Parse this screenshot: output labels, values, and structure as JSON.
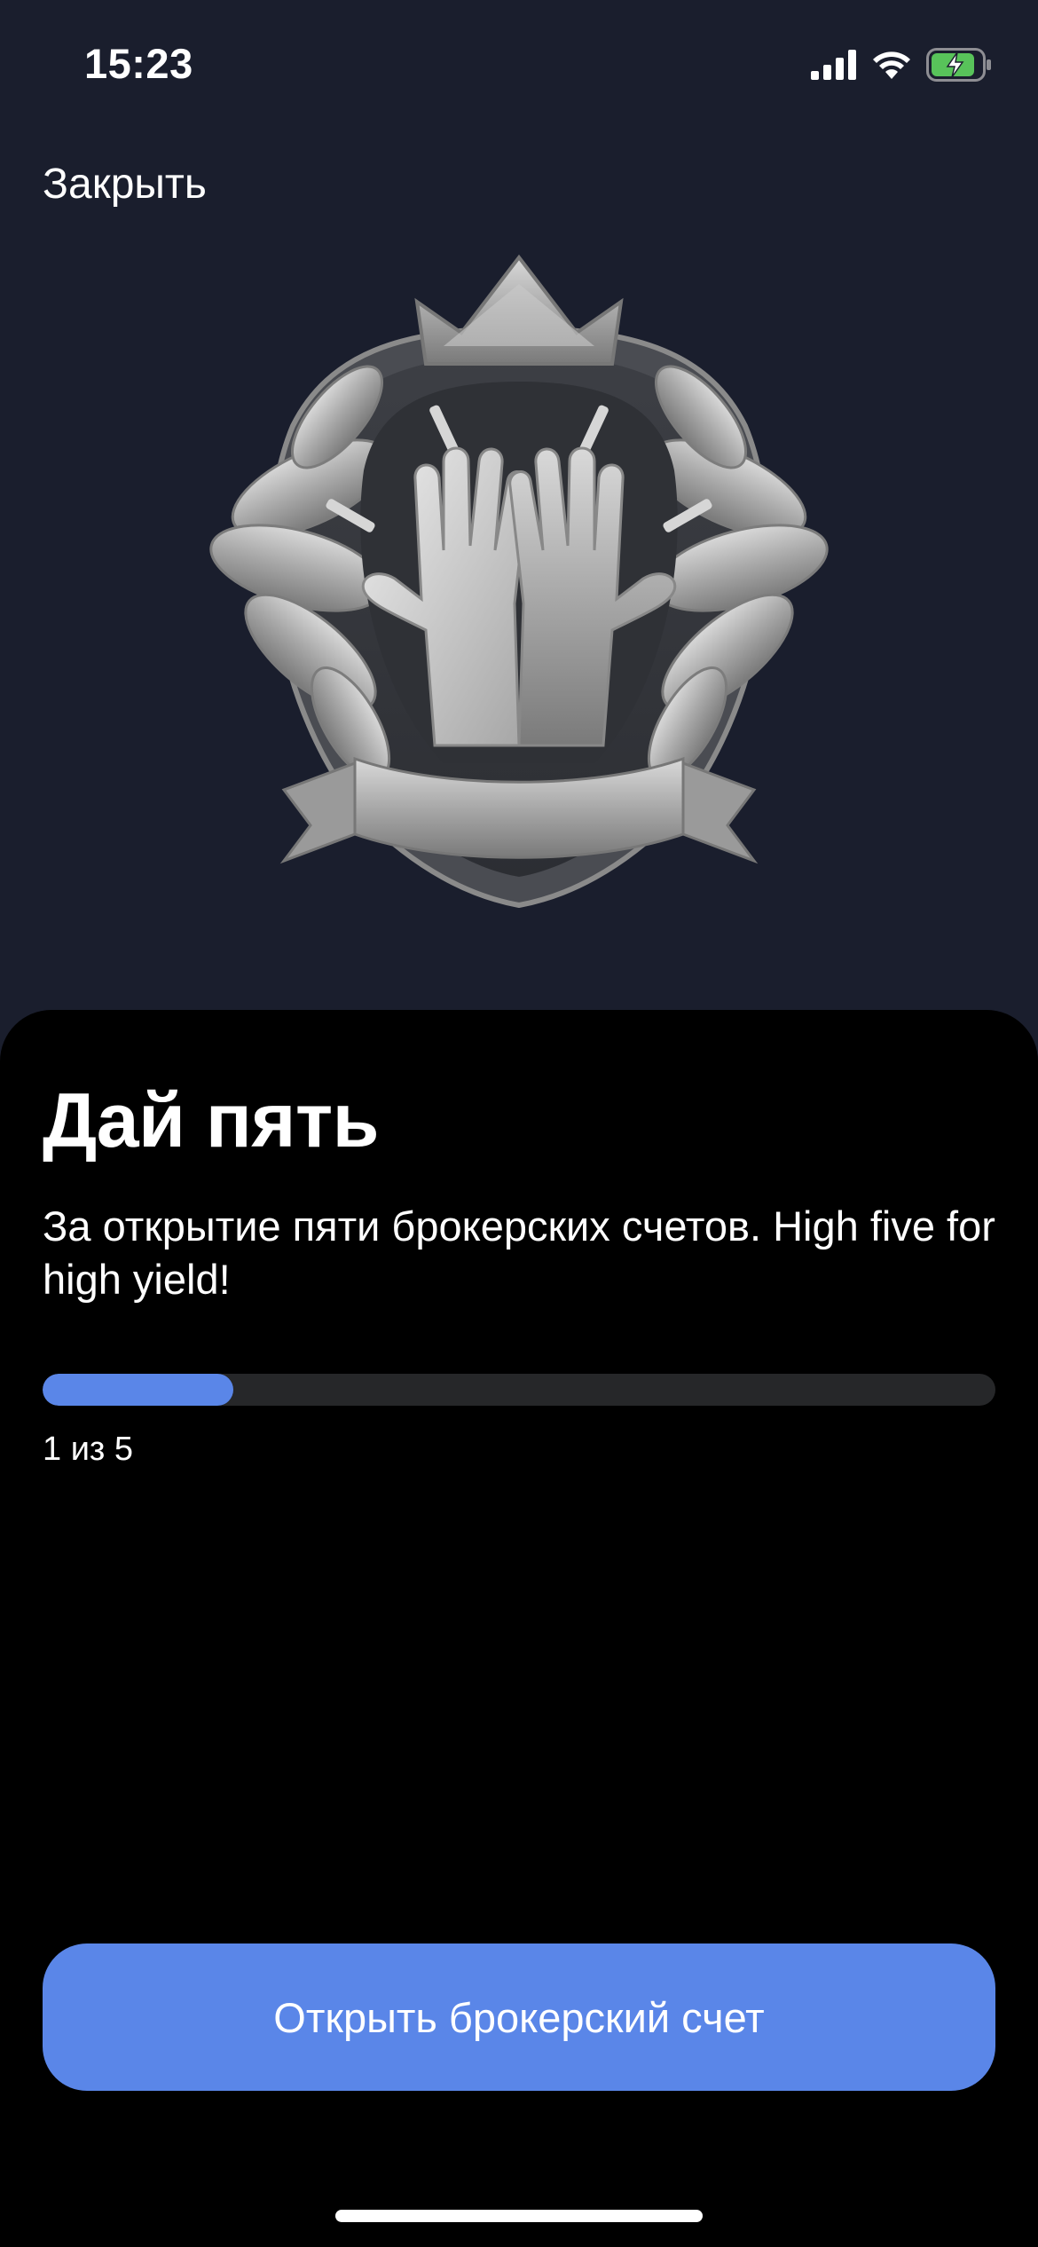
{
  "status_bar": {
    "time": "15:23",
    "icons": [
      "cellular-signal-icon",
      "wifi-icon",
      "battery-charging-icon"
    ],
    "battery_color": "#58c35a"
  },
  "header": {
    "close_label": "Закрыть"
  },
  "badge": {
    "icon": "high-five-badge-icon"
  },
  "achievement": {
    "title": "Дай пять",
    "description": "За открытие пяти брокерских счетов. High five for high yield!",
    "progress_current": 1,
    "progress_total": 5,
    "progress_fraction": 0.2,
    "progress_text": "1 из 5"
  },
  "cta": {
    "label": "Открыть брокерский счет"
  },
  "colors": {
    "background_top": "#1a1e2d",
    "sheet": "#000000",
    "accent": "#5a86e8",
    "track": "#262729"
  }
}
